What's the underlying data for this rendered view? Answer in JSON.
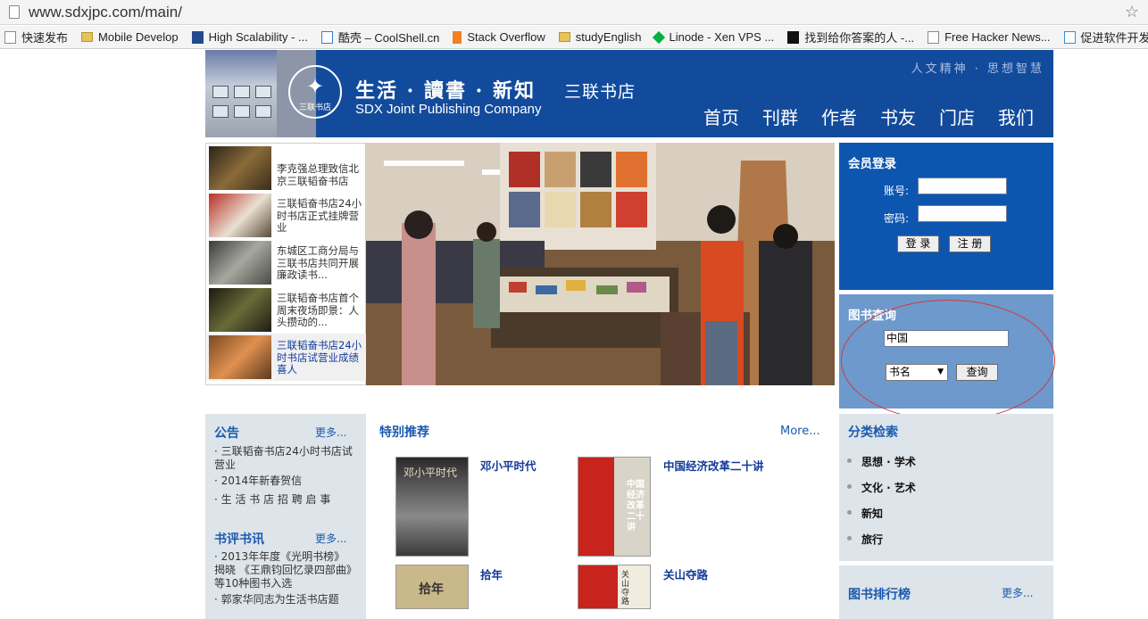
{
  "browser": {
    "url": "www.sdxjpc.com/main/",
    "bookmarks": [
      "快速发布",
      "Mobile Develop",
      "High Scalability - ...",
      "酷壳 – CoolShell.cn",
      "Stack Overflow",
      "studyEnglish",
      "Linode - Xen VPS ...",
      "找到给你答案的人 -...",
      "Free Hacker News...",
      "促进软件开发领域"
    ]
  },
  "header": {
    "seal_text": "三联书店",
    "brand_cn": "生活 · 讀書 · 新知",
    "brand_store": "三联书店",
    "brand_en": "SDX Joint Publishing Company",
    "slogan": "人文精神 · 思想智慧",
    "nav": [
      "首页",
      "刊群",
      "作者",
      "书友",
      "门店",
      "我们"
    ]
  },
  "news": [
    {
      "title": "李克强总理致信北京三联韬奋书店"
    },
    {
      "title": "三联韬奋书店24小时书店正式挂牌营业"
    },
    {
      "title": "东城区工商分局与三联书店共同开展廉政读书..."
    },
    {
      "title": "三联韬奋书店首个周末夜场即景：人头攒动的..."
    },
    {
      "title": "三联韬奋书店24小时书店试营业成绩喜人"
    }
  ],
  "login": {
    "title": "会员登录",
    "account_label": "账号:",
    "password_label": "密码:",
    "login_button": "登 录",
    "register_button": "注 册"
  },
  "book_search": {
    "title": "图书查询",
    "query_value": "中国",
    "field_select": "书名",
    "submit_button": "查询"
  },
  "categories": {
    "title": "分类检索",
    "items": [
      "思想 · 学术",
      "文化 · 艺术",
      "新知",
      "旅行"
    ]
  },
  "ranking": {
    "title": "图书排行榜",
    "more": "更多..."
  },
  "announcements": {
    "title": "公告",
    "more": "更多...",
    "items": [
      "三联韬奋书店24小时书店试营业",
      "2014年新春贺信",
      "生 活 书 店 招 聘 启 事"
    ]
  },
  "book_reviews": {
    "title": "书评书讯",
    "more": "更多...",
    "items": [
      "2013年年度《光明书榜》揭晓 《王鼎钧回忆录四部曲》等10种图书入选",
      "郭家华同志为生活书店题"
    ]
  },
  "recommend": {
    "title": "特别推荐",
    "more": "More...",
    "books": [
      {
        "title": "邓小平时代",
        "cover_text": "邓小平时代"
      },
      {
        "title": "中国经济改革二十讲",
        "cover_text": "中国经济改革二十讲"
      },
      {
        "title": "拾年",
        "cover_text": "拾年"
      },
      {
        "title": "关山夺路",
        "cover_text": "关山夺路"
      }
    ]
  },
  "colors": {
    "header_blue": "#134b9c",
    "login_blue": "#0d56b0",
    "search_blue": "#6d99cc",
    "link_blue": "#1a5ab0",
    "annotation_red": "#d23a3a"
  }
}
